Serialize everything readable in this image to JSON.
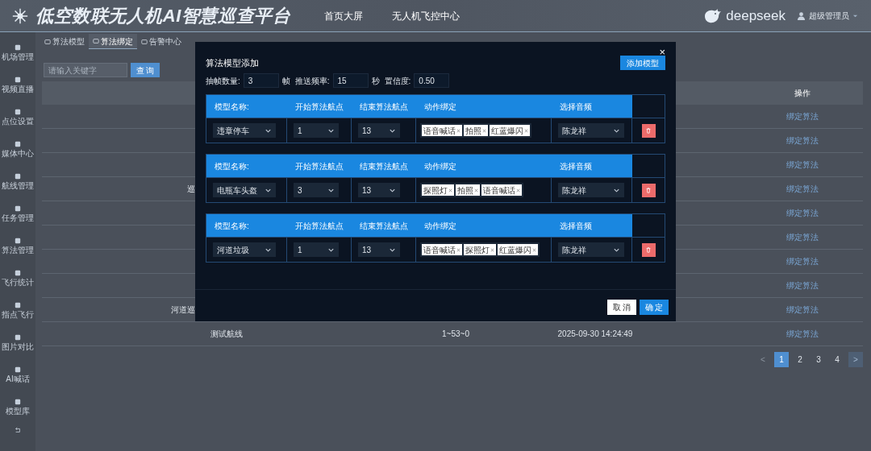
{
  "header": {
    "title": "低空数联无人机AI智慧巡查平台",
    "nav": [
      "首页大屏",
      "无人机飞控中心"
    ],
    "brand": "deepseek",
    "user": "超级管理员"
  },
  "sidebar": {
    "items": [
      {
        "label": "机场管理"
      },
      {
        "label": "视频直播"
      },
      {
        "label": "点位设置"
      },
      {
        "label": "媒体中心"
      },
      {
        "label": "航线管理"
      },
      {
        "label": "任务管理"
      },
      {
        "label": "算法管理"
      },
      {
        "label": "飞行统计"
      },
      {
        "label": "指点飞行"
      },
      {
        "label": "图片对比"
      },
      {
        "label": "AI喊话"
      },
      {
        "label": "模型库"
      }
    ]
  },
  "tabs": [
    {
      "label": "算法模型",
      "selected": false
    },
    {
      "label": "算法绑定",
      "selected": true
    },
    {
      "label": "告警中心",
      "selected": false
    }
  ],
  "search": {
    "placeholder": "请输入关键字",
    "button": "查 询"
  },
  "table": {
    "columns": [
      "操作"
    ],
    "rows": [
      {
        "action": "绑定算法"
      },
      {
        "action": "绑定算法"
      },
      {
        "action": "绑定算法"
      },
      {
        "column_1": "巡",
        "action": "绑定算法"
      },
      {
        "action": "绑定算法"
      },
      {
        "action": "绑定算法"
      },
      {
        "action": "绑定算法"
      },
      {
        "action": "绑定算法"
      },
      {
        "column_1": "河道巡",
        "action": "绑定算法"
      },
      {
        "column_1": "测试航线",
        "column_2": "1~53~0",
        "column_3": "2025-09-30 14:24:49",
        "action": "绑定算法"
      }
    ]
  },
  "pagination": {
    "prev": "<",
    "next": ">",
    "pages": [
      {
        "label": "1",
        "selected": true
      },
      {
        "label": "2",
        "selected": false
      },
      {
        "label": "3",
        "selected": false
      },
      {
        "label": "4",
        "selected": false
      }
    ]
  },
  "dialog": {
    "title": "算法模型添加",
    "close": "×",
    "add_button": "添加模型",
    "params": [
      {
        "label": "抽帧数量:",
        "value": "3",
        "unit": "帧"
      },
      {
        "label": "推送频率:",
        "value": "15",
        "unit": "秒"
      },
      {
        "label": "置信度:",
        "value": "0.50"
      }
    ],
    "models": [
      {
        "columns": [
          "模型名称:",
          "开始算法航点",
          "结束算法航点",
          "动作绑定",
          "选择音频"
        ],
        "name": "违章停车",
        "start": "1",
        "end": "13",
        "actions": [
          "语音喊话",
          "拍照",
          "红蓝爆闪"
        ],
        "audio": "陈龙祥"
      },
      {
        "columns": [
          "模型名称:",
          "开始算法航点",
          "结束算法航点",
          "动作绑定",
          "选择音频"
        ],
        "name": "电瓶车头盔",
        "start": "3",
        "end": "13",
        "actions": [
          "探照灯",
          "拍照",
          "语音喊话"
        ],
        "audio": "陈龙祥"
      },
      {
        "columns": [
          "模型名称:",
          "开始算法航点",
          "结束算法航点",
          "动作绑定",
          "选择音频"
        ],
        "name": "河道垃圾",
        "start": "1",
        "end": "13",
        "actions": [
          "语音喊话",
          "探照灯",
          "红蓝爆闪"
        ],
        "audio": "陈龙祥"
      }
    ],
    "cancel": "取 消",
    "confirm": "确 定"
  }
}
